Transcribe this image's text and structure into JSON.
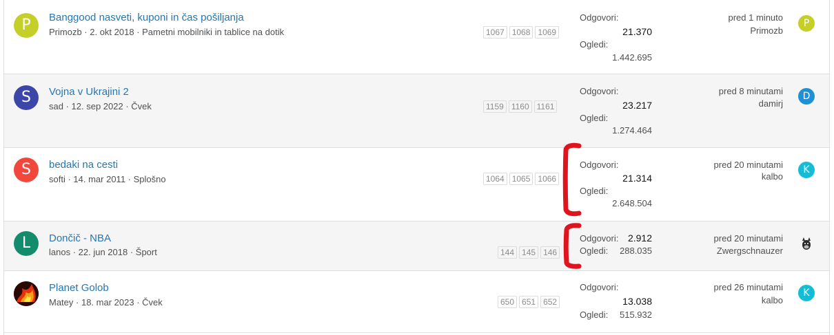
{
  "labels": {
    "replies": "Odgovori:",
    "views": "Ogledi:"
  },
  "threads": [
    {
      "avatar_letter": "P",
      "avatar_color": "#c5cf2a",
      "title": "Banggood nasveti, kuponi in čas pošiljanja",
      "author": "Primozb",
      "date": "2. okt 2018",
      "forum": "Pametni mobilniki in tablice na dotik",
      "pages": [
        "1067",
        "1068",
        "1069"
      ],
      "replies": "21.370",
      "views": "1.442.695",
      "last_time": "pred 1 minuto",
      "last_user": "Primozb",
      "last_avatar_letter": "P",
      "last_avatar_color": "#c5cf2a"
    },
    {
      "avatar_letter": "S",
      "avatar_color": "#3c46a8",
      "title": "Vojna v Ukrajini 2",
      "author": "sad",
      "date": "12. sep 2022",
      "forum": "Čvek",
      "pages": [
        "1159",
        "1160",
        "1161"
      ],
      "replies": "23.217",
      "views": "1.274.464",
      "last_time": "pred 8 minutami",
      "last_user": "damirj",
      "last_avatar_letter": "D",
      "last_avatar_color": "#1f8fd6"
    },
    {
      "avatar_letter": "S",
      "avatar_color": "#f2473d",
      "title": "bedaki na cesti",
      "author": "softi",
      "date": "14. mar 2011",
      "forum": "Splošno",
      "pages": [
        "1064",
        "1065",
        "1066"
      ],
      "replies": "21.314",
      "views": "2.648.504",
      "last_time": "pred 20 minutami",
      "last_user": "kalbo",
      "last_avatar_letter": "K",
      "last_avatar_color": "#14bdd6"
    },
    {
      "avatar_letter": "L",
      "avatar_color": "#138c6e",
      "title": "Dončič - NBA",
      "author": "lanos",
      "date": "22. jun 2018",
      "forum": "Šport",
      "pages": [
        "144",
        "145",
        "146"
      ],
      "replies": "2.912",
      "views": "288.035",
      "last_time": "pred 20 minutami",
      "last_user": "Zwergschnauzer",
      "last_avatar_icon": "dog-avatar-icon"
    },
    {
      "avatar_icon": "fire-photo-avatar-icon",
      "title": "Planet Golob",
      "author": "Matey",
      "date": "18. mar 2023",
      "forum": "Čvek",
      "pages": [
        "650",
        "651",
        "652"
      ],
      "replies": "13.038",
      "views": "515.932",
      "last_time": "pred 26 minutami",
      "last_user": "kalbo",
      "last_avatar_letter": "K",
      "last_avatar_color": "#14bdd6"
    }
  ],
  "annotation_color": "#e0141e"
}
